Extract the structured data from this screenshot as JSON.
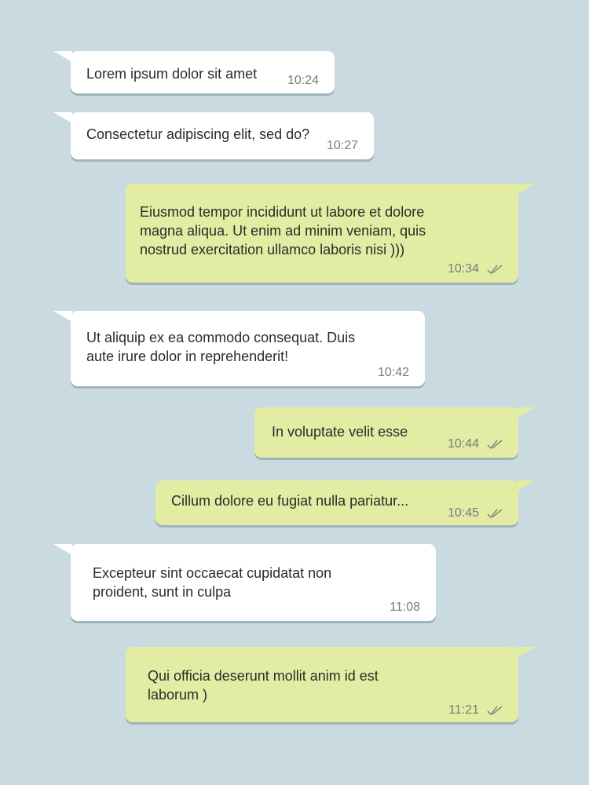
{
  "messages": [
    {
      "direction": "incoming",
      "text": "Lorem ipsum dolor sit amet",
      "time": "10:24"
    },
    {
      "direction": "incoming",
      "text": "Consectetur adipiscing elit, sed do?",
      "time": "10:27"
    },
    {
      "direction": "outgoing",
      "text": "Eiusmod tempor incididunt ut labore et dolore\n magna aliqua. Ut enim ad minim veniam, quis\n nostrud exercitation ullamco laboris nisi )))",
      "time": "10:34",
      "status_icon": "double-check-icon"
    },
    {
      "direction": "incoming",
      "text": "Ut aliquip ex ea commodo consequat. Duis\naute irure dolor in reprehenderit!",
      "time": "10:42"
    },
    {
      "direction": "outgoing",
      "text": "In voluptate velit esse",
      "time": "10:44",
      "status_icon": "double-check-icon"
    },
    {
      "direction": "outgoing",
      "text": "Cillum dolore eu fugiat nulla pariatur...",
      "time": "10:45",
      "status_icon": "double-check-icon"
    },
    {
      "direction": "incoming",
      "text": "Excepteur sint occaecat cupidatat non\nproident, sunt in culpa",
      "time": "11:08"
    },
    {
      "direction": "outgoing",
      "text": "Qui officia deserunt mollit anim id est\nlaborum )",
      "time": "11:21",
      "status_icon": "double-check-icon"
    }
  ],
  "colors": {
    "background": "#c9dae1",
    "incoming_bubble": "#ffffff",
    "outgoing_bubble": "#e3eca3",
    "text": "#2b2b2b",
    "meta": "#7a7a7a"
  }
}
